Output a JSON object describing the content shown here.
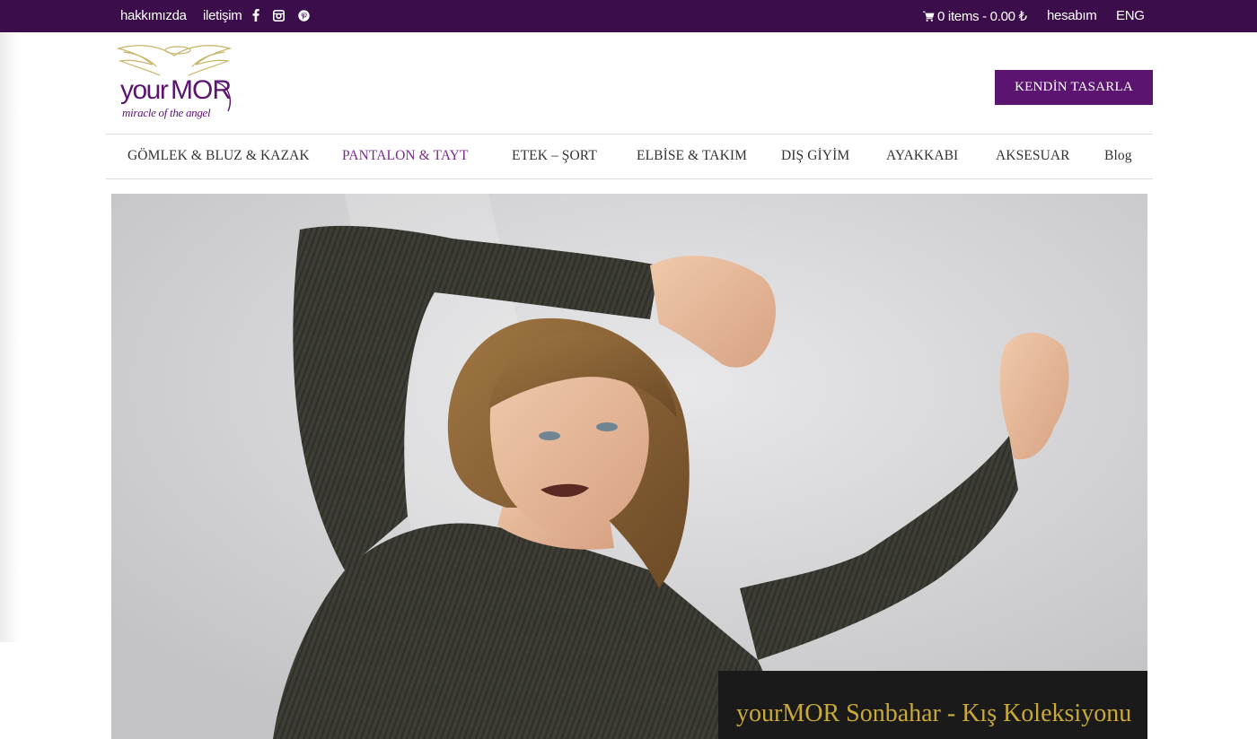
{
  "topbar": {
    "about": "hakkımızda",
    "contact": "iletişim",
    "social_icons": [
      "facebook-icon",
      "instagram-icon",
      "pinterest-icon"
    ],
    "cart": "0 items - 0.00 ₺",
    "account": "hesabım",
    "language": "ENG"
  },
  "header": {
    "logo_text": "yourMOR",
    "logo_tagline": "miracle of the angel",
    "cta_button": "KENDİN TASARLA"
  },
  "nav": {
    "items": [
      {
        "label": "GÖMLEK & BLUZ & KAZAK"
      },
      {
        "label": "PANTALON & TAYT",
        "active": true
      },
      {
        "label": "ETEK – ŞORT"
      },
      {
        "label": "ELBİSE & TAKIM"
      },
      {
        "label": "DIŞ GİYİM"
      },
      {
        "label": "AYAKKABI"
      },
      {
        "label": "AKSESUAR"
      },
      {
        "label": "Blog"
      }
    ]
  },
  "hero": {
    "caption": "yourMOR Sonbahar - Kış Koleksiyonu"
  },
  "colors": {
    "topbar_bg": "#3b0e4b",
    "brand_purple": "#5b1570",
    "nav_active": "#7a2a8f",
    "caption_gold": "#c9a93b"
  }
}
